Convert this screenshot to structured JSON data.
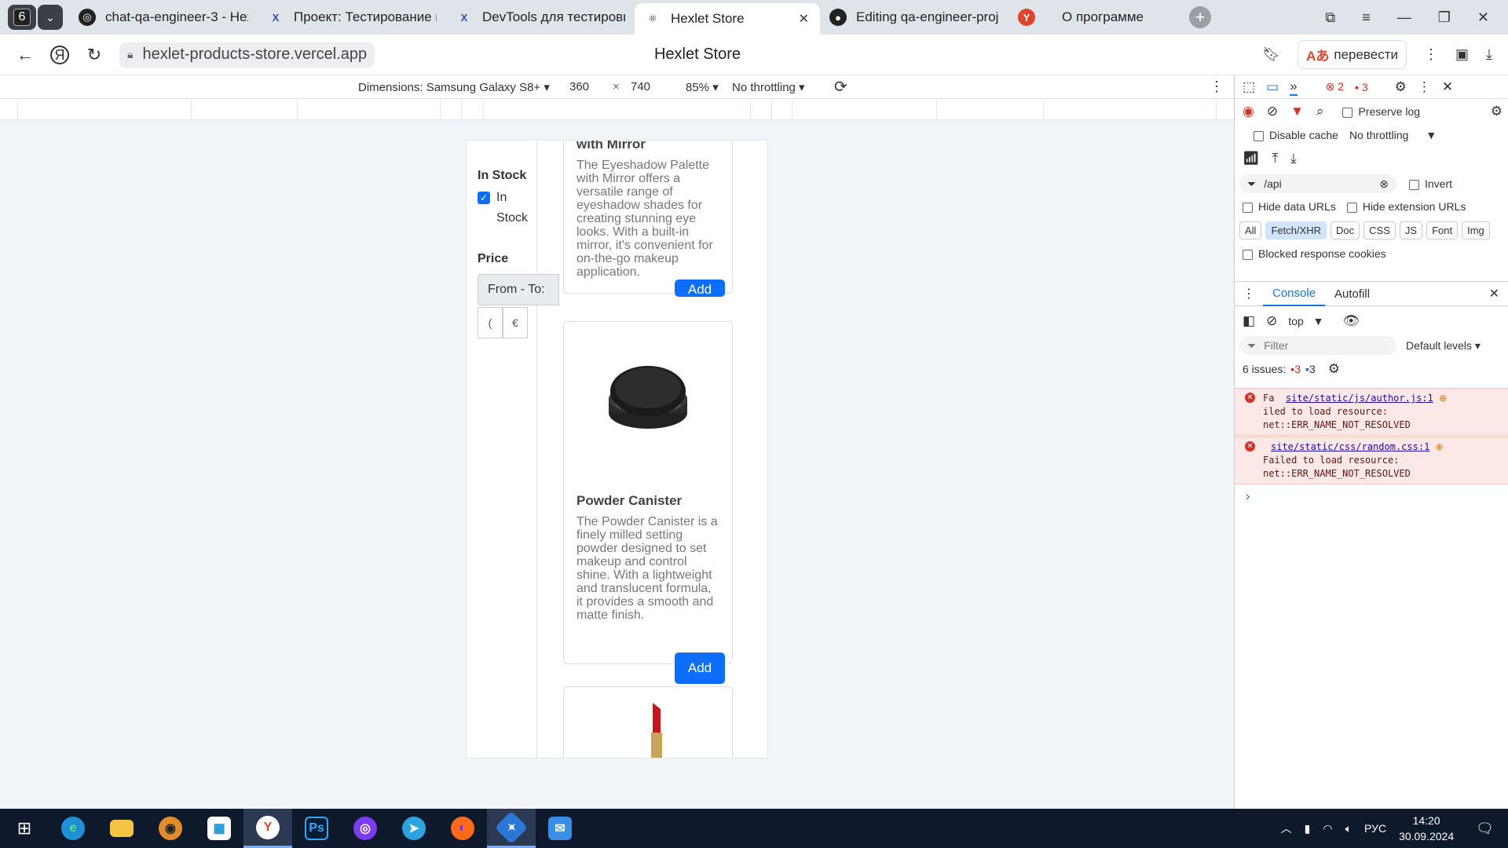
{
  "tabs": {
    "counter": "6",
    "items": [
      {
        "label": "chat-qa-engineer-3 - Hex",
        "icon": "openai-icon",
        "active": false
      },
      {
        "label": "Проект: Тестирование и",
        "icon": "hexlet-icon",
        "active": false
      },
      {
        "label": "DevTools для тестировщ",
        "icon": "hexlet-icon",
        "active": false
      },
      {
        "label": "Hexlet Store",
        "icon": "react-icon",
        "active": true
      },
      {
        "label": "Editing qa-engineer-proje",
        "icon": "github-icon",
        "active": false
      },
      {
        "label": "О программе",
        "icon": "yandex-icon",
        "active": false
      }
    ]
  },
  "address": {
    "url": "hexlet-products-store.vercel.app",
    "title": "Hexlet Store",
    "translate": "перевести"
  },
  "device_toolbar": {
    "dimensions": "Dimensions: Samsung Galaxy S8+ ▾",
    "width": "360",
    "x": "×",
    "height": "740",
    "zoom": "85% ▾",
    "throttling": "No throttling ▾"
  },
  "store": {
    "in_stock_title": "In Stock",
    "in_stock_label_1": "In",
    "in_stock_label_2": "Stock",
    "price_title": "Price",
    "price_range": "From - To:",
    "price_from": "(",
    "price_to": "€",
    "products": [
      {
        "name": "with Mirror",
        "desc": "The Eyeshadow Palette with Mirror offers a versatile range of eyeshadow shades for creating stunning eye looks. With a built-in mirror, it's convenient for on-the-go makeup application.",
        "add": "Add"
      },
      {
        "name": "Powder Canister",
        "desc": "The Powder Canister is a finely milled setting powder designed to set makeup and control shine. With a lightweight and translucent formula, it provides a smooth and matte finish.",
        "add": "Add"
      }
    ]
  },
  "devtools": {
    "errors": "2",
    "warnings": "3",
    "preserve_log": "Preserve log",
    "disable_cache": "Disable cache",
    "throttling": "No throttling",
    "filter_value": "/api",
    "invert": "Invert",
    "hide_data_urls": "Hide data URLs",
    "hide_ext_urls": "Hide extension URLs",
    "types": [
      "All",
      "Fetch/XHR",
      "Doc",
      "CSS",
      "JS",
      "Font",
      "Img"
    ],
    "blocked_cookies": "Blocked response cookies",
    "drawer_tabs": [
      "Console",
      "Autofill"
    ],
    "context": "top",
    "console_filter": "Filter",
    "levels": "Default levels",
    "issues_label": "6 issues:",
    "issues_err": "3",
    "issues_info": "3",
    "messages": [
      {
        "link": "site/static/js/author.js:1",
        "prefix": "Fa",
        "text": "iled to load resource: net::ERR_NAME_NOT_RESOLVED"
      },
      {
        "link": "site/static/css/random.css:1",
        "prefix": "",
        "text": "Failed to load resource: net::ERR_NAME_NOT_RESOLVED"
      }
    ]
  },
  "taskbar": {
    "lang": "РУС",
    "time": "14:20",
    "date": "30.09.2024"
  }
}
